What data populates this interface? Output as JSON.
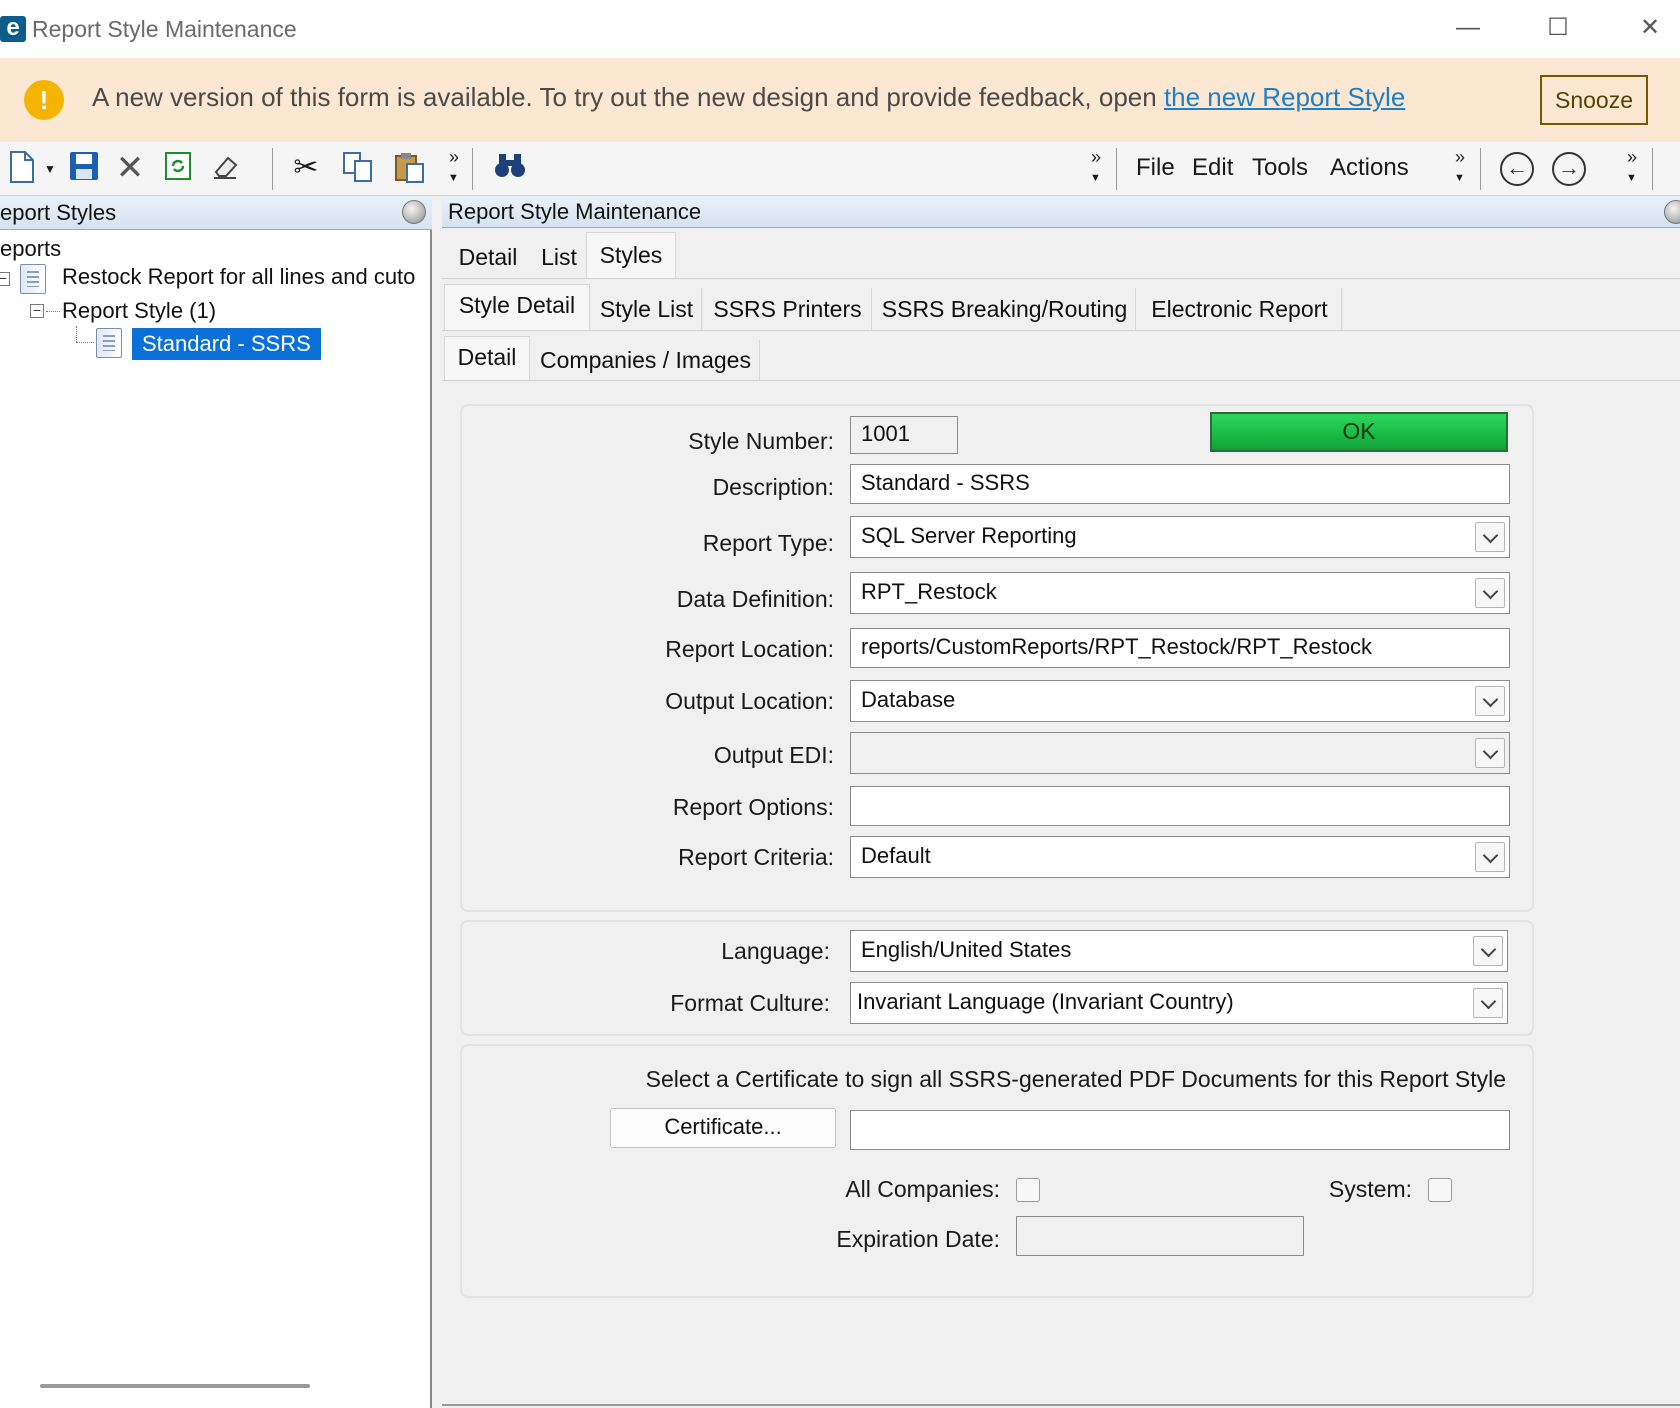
{
  "window": {
    "logo": "e",
    "title": "Report Style Maintenance",
    "controls": {
      "minimize": "—",
      "maximize": "☐",
      "close": "✕"
    }
  },
  "banner": {
    "icon": "!",
    "text": "A new version of this form is available. To try out the new design and provide feedback, open ",
    "link": "the new Report Style",
    "snooze": "Snooze"
  },
  "toolbar": {
    "icons": [
      "new-document-icon",
      "save-icon",
      "delete-icon",
      "refresh-icon",
      "clear-icon",
      "cut-icon",
      "copy-icon",
      "paste-icon",
      "binoculars-icon",
      "back-arrow-icon",
      "forward-arrow-icon"
    ],
    "overflow_glyph": "»",
    "menus": [
      "File",
      "Edit",
      "Tools",
      "Actions"
    ]
  },
  "tree": {
    "header": "eport Styles",
    "root": "eports",
    "node1": "Restock Report for all lines and cuto",
    "node2": "Report Style (1)",
    "node3": "Standard - SSRS",
    "expand_glyph": "−"
  },
  "panel": {
    "header": "Report Style Maintenance",
    "tabs_top": [
      "Detail",
      "List",
      "Styles"
    ],
    "tabs_mid": [
      "Style Detail",
      "Style List",
      "SSRS Printers",
      "SSRS Breaking/Routing",
      "Electronic Report"
    ],
    "tabs_sub": [
      "Detail",
      "Companies / Images"
    ]
  },
  "form": {
    "style_number_label": "Style Number:",
    "style_number": "1001",
    "ok": "OK",
    "description_label": "Description:",
    "description": "Standard - SSRS",
    "report_type_label": "Report Type:",
    "report_type": "SQL Server Reporting",
    "data_definition_label": "Data Definition:",
    "data_definition": "RPT_Restock",
    "report_location_label": "Report Location:",
    "report_location": "reports/CustomReports/RPT_Restock/RPT_Restock",
    "output_location_label": "Output Location:",
    "output_location": "Database",
    "output_edi_label": "Output EDI:",
    "output_edi": "",
    "report_options_label": "Report Options:",
    "report_options": "",
    "report_criteria_label": "Report Criteria:",
    "report_criteria": "Default",
    "language_label": "Language:",
    "language": "English/United States",
    "format_culture_label": "Format Culture:",
    "format_culture": "Invariant Language (Invariant Country)",
    "cert_text": "Select a Certificate to sign all SSRS-generated PDF Documents for this Report Style",
    "cert_button": "Certificate...",
    "cert_value": "",
    "all_companies_label": "All Companies:",
    "all_companies": false,
    "system_label": "System:",
    "system": false,
    "expiration_label": "Expiration Date:",
    "expiration_date": ""
  },
  "colors": {
    "ok_button": "#1fc046",
    "banner_bg": "#fce8d2",
    "selection": "#0a70d8",
    "link": "#1e7fc9"
  }
}
